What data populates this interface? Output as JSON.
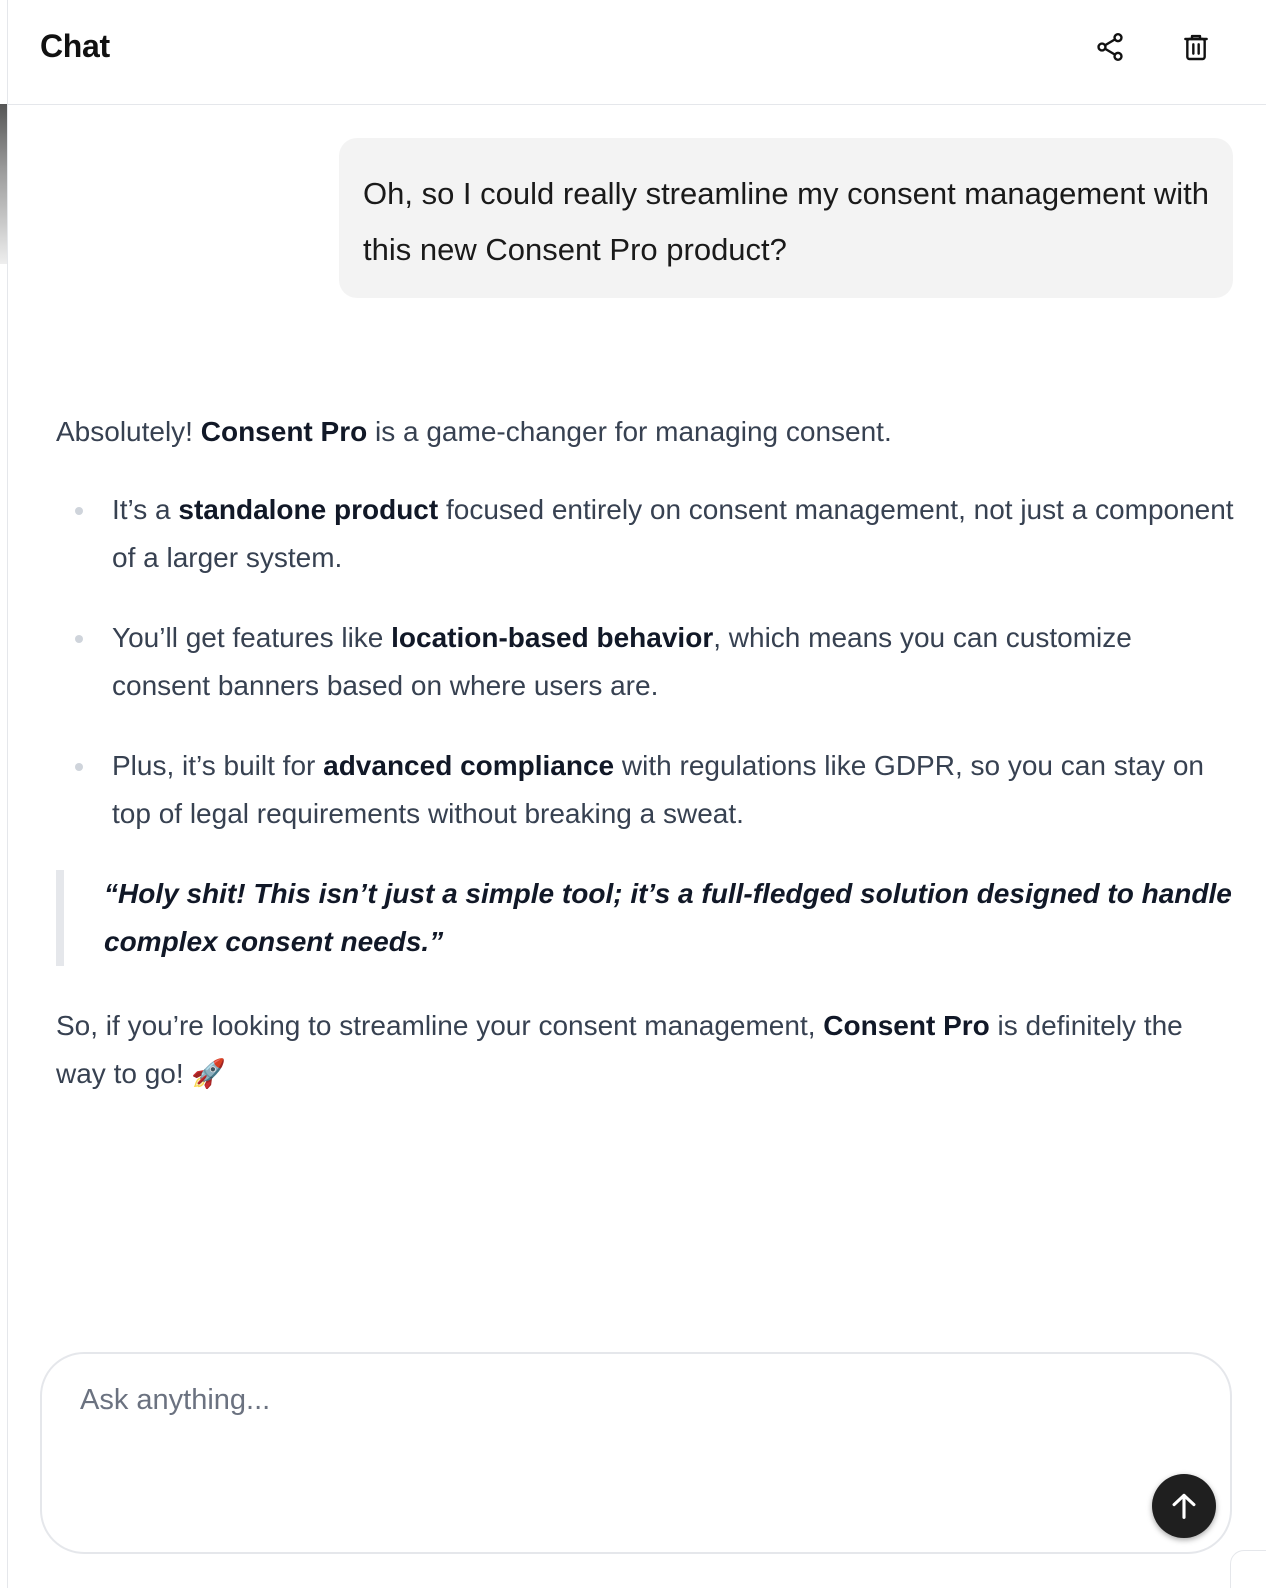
{
  "header": {
    "title": "Chat",
    "share_icon": "share-icon",
    "delete_icon": "trash-icon"
  },
  "user_message": {
    "text": "Oh, so I could really streamline my consent management with this new Consent Pro product?"
  },
  "assistant_message": {
    "intro": {
      "pre": "Absolutely! ",
      "bold": "Consent Pro",
      "post": " is a game-changer for managing consent."
    },
    "bullets": [
      {
        "pre": "It’s a ",
        "bold": "standalone product",
        "post": " focused entirely on consent management, not just a component of a larger system."
      },
      {
        "pre": "You’ll get features like ",
        "bold": "location-based behavior",
        "post": ", which means you can customize consent banners based on where users are."
      },
      {
        "pre": "Plus, it’s built for ",
        "bold": "advanced compliance",
        "post": " with regulations like GDPR, so you can stay on top of legal requirements without breaking a sweat."
      }
    ],
    "quote": "“Holy shit! This isn’t just a simple tool; it’s a full-fledged solution designed to handle complex consent needs.”",
    "outro": {
      "pre": "So, if you’re looking to streamline your consent management, ",
      "bold": "Consent Pro",
      "post": " is definitely the way to go! 🚀"
    }
  },
  "composer": {
    "placeholder": "Ask anything...",
    "value": "",
    "send_icon": "arrow-up-icon"
  },
  "colors": {
    "bubble_bg": "#f3f3f3",
    "send_button_bg": "#1f1f1f",
    "border": "#e5e7eb"
  }
}
